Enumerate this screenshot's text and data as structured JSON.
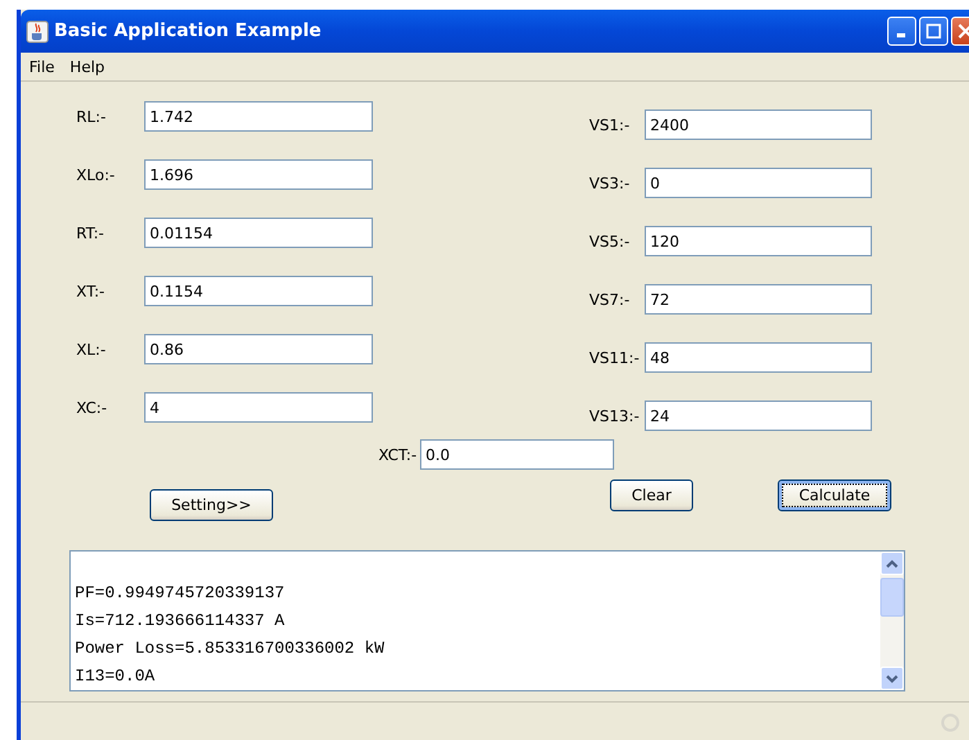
{
  "window": {
    "title": "Basic Application Example"
  },
  "menu": [
    "File",
    "Help"
  ],
  "left_fields": [
    {
      "label": "RL:-",
      "value": "1.742"
    },
    {
      "label": "XLo:-",
      "value": "1.696"
    },
    {
      "label": "RT:-",
      "value": "0.01154"
    },
    {
      "label": "XT:-",
      "value": "0.1154"
    },
    {
      "label": "XL:-",
      "value": "0.86"
    },
    {
      "label": "XC:-",
      "value": "4"
    }
  ],
  "right_fields": [
    {
      "label": "VS1:-",
      "value": "2400"
    },
    {
      "label": "VS3:-",
      "value": "0"
    },
    {
      "label": "VS5:-",
      "value": "120"
    },
    {
      "label": "VS7:-",
      "value": "72"
    },
    {
      "label": "VS11:-",
      "value": "48"
    },
    {
      "label": "VS13:-",
      "value": "24"
    }
  ],
  "xct": {
    "label": "XCT:-",
    "value": "0.0"
  },
  "buttons": [
    {
      "label": "Setting>>",
      "focused": false
    },
    {
      "label": "Clear",
      "focused": false
    },
    {
      "label": "Calculate",
      "focused": true
    }
  ],
  "output": {
    "lines": [
      "PF=0.9949745720339137",
      "Is=712.193666114337 A",
      "Power Loss=5.853316700336002 kW",
      "I13=0.0A"
    ]
  }
}
